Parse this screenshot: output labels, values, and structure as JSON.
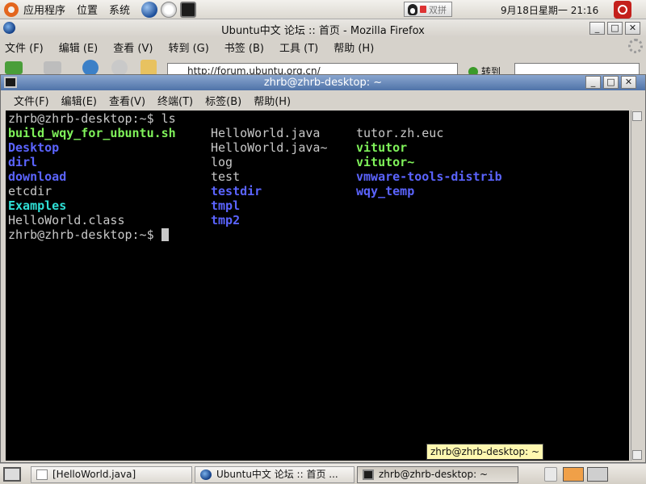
{
  "top_panel": {
    "menus": [
      "应用程序",
      "位置",
      "系统"
    ],
    "ime_label": "双拼",
    "clock": "9月18日星期一 21:16"
  },
  "firefox": {
    "title": "Ubuntu中文 论坛 :: 首页 - Mozilla Firefox",
    "menus": [
      "文件 (F)",
      "编辑 (E)",
      "查看 (V)",
      "转到 (G)",
      "书签 (B)",
      "工具 (T)",
      "帮助 (H)"
    ],
    "url": "http://forum.ubuntu.org.cn/",
    "go_label": "转到"
  },
  "terminal": {
    "title": "zhrb@zhrb-desktop: ~",
    "menus": [
      "文件(F)",
      "编辑(E)",
      "查看(V)",
      "终端(T)",
      "标签(B)",
      "帮助(H)"
    ],
    "prompt": "zhrb@zhrb-desktop:~$",
    "command": "ls",
    "ls_rows": [
      [
        "build_wqy_for_ubuntu.sh",
        "HelloWorld.java",
        "tutor.zh.euc"
      ],
      [
        "Desktop",
        "HelloWorld.java~",
        "vitutor"
      ],
      [
        "dirl",
        "log",
        "vitutor~"
      ],
      [
        "download",
        "test",
        "vmware-tools-distrib"
      ],
      [
        "etcdir",
        "testdir",
        "wqy_temp"
      ],
      [
        "Examples",
        "tmpl",
        ""
      ],
      [
        "HelloWorld.class",
        "tmp2",
        ""
      ]
    ],
    "colors": {
      "executable": "#7ff25a",
      "directory": "#5b64ff",
      "link": "#2fe0d6",
      "plain": "#c8c8c8"
    },
    "tooltip": "zhrb@zhrb-desktop: ~"
  },
  "taskbar": {
    "tasks": [
      {
        "label": "[HelloWorld.java]",
        "icon": "document-icon"
      },
      {
        "label": "Ubuntu中文 论坛 :: 首页 ...",
        "icon": "firefox-icon"
      },
      {
        "label": "zhrb@zhrb-desktop: ~",
        "icon": "terminal-icon"
      }
    ]
  }
}
